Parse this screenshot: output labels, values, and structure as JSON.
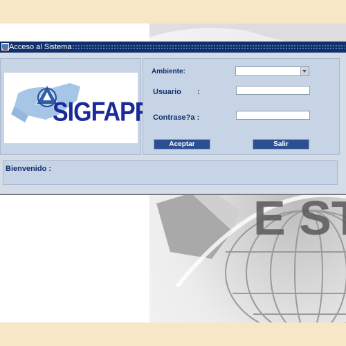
{
  "window": {
    "title": "Acceso al Sistema"
  },
  "logo": {
    "text": "SIGFAPRO"
  },
  "form": {
    "ambiente_label": "Ambiente:",
    "ambiente_value": "",
    "usuario_label": "Usuario",
    "usuario_colon": ":",
    "usuario_value": "",
    "password_label": "Contrase?a :",
    "password_value": "",
    "accept_button": "Aceptar",
    "exit_button": "Salir"
  },
  "status": {
    "welcome_label": "Bienvenido :"
  }
}
